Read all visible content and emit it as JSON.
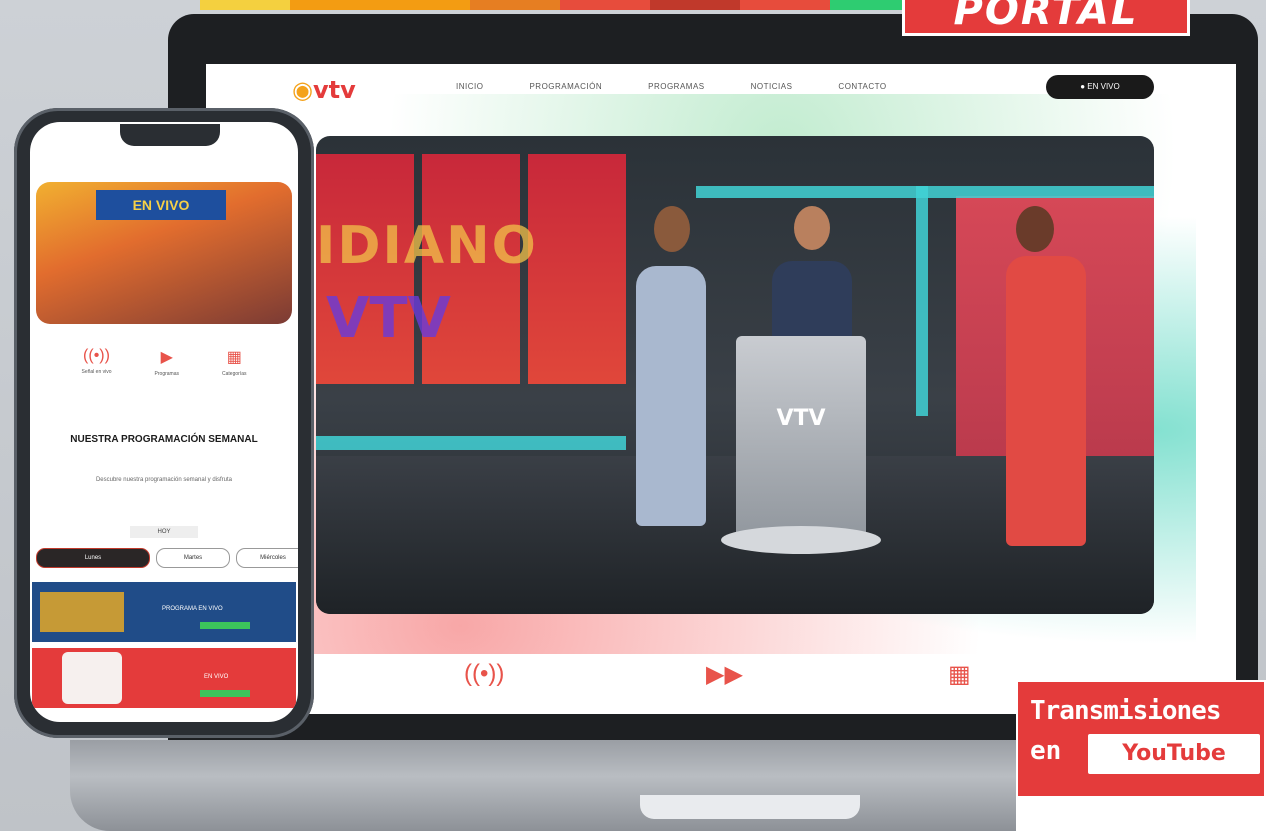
{
  "top_strip_colors": [
    "#f4d03f",
    "#f39c12",
    "#f39c12",
    "#e67e22",
    "#e74c3c",
    "#c0392b",
    "#e74c3c",
    "#2ecc71"
  ],
  "portal_badge": {
    "label": "PORTAL"
  },
  "site": {
    "logo": {
      "prefix": "◉",
      "text": "vtv"
    },
    "nav": [
      "INICIO",
      "PROGRAMACIÓN",
      "PROGRAMAS",
      "NOTICIAS",
      "CONTACTO"
    ],
    "cta_label": "● EN VIVO",
    "video": {
      "set_text": "IDIANO",
      "set_logo": "VTV",
      "podium_label": "VTV"
    },
    "icons": [
      "broadcast-icon",
      "video-icon",
      "grid-icon"
    ]
  },
  "phone": {
    "hero_banner": "EN VIVO",
    "icons": [
      {
        "name": "broadcast-icon",
        "label": "Señal en vivo"
      },
      {
        "name": "video-icon",
        "label": "Programas"
      },
      {
        "name": "grid-icon",
        "label": "Categorías"
      }
    ],
    "heading": "NUESTRA PROGRAMACIÓN SEMANAL",
    "subtext": "Descubre nuestra programación semanal y disfruta",
    "date": "HOY",
    "tabs": [
      "Lunes",
      "Martes",
      "Miércoles"
    ],
    "card1": {
      "text": "PROGRAMA EN VIVO"
    },
    "card2": {
      "text": "EN VIVO"
    }
  },
  "trans_badge": {
    "line1": "Transmisiones",
    "line2": "en",
    "platform": "YouTube"
  },
  "colors": {
    "brand_red": "#e43b3b",
    "accent_green": "#3cc45b",
    "dark": "#1d1f22"
  }
}
